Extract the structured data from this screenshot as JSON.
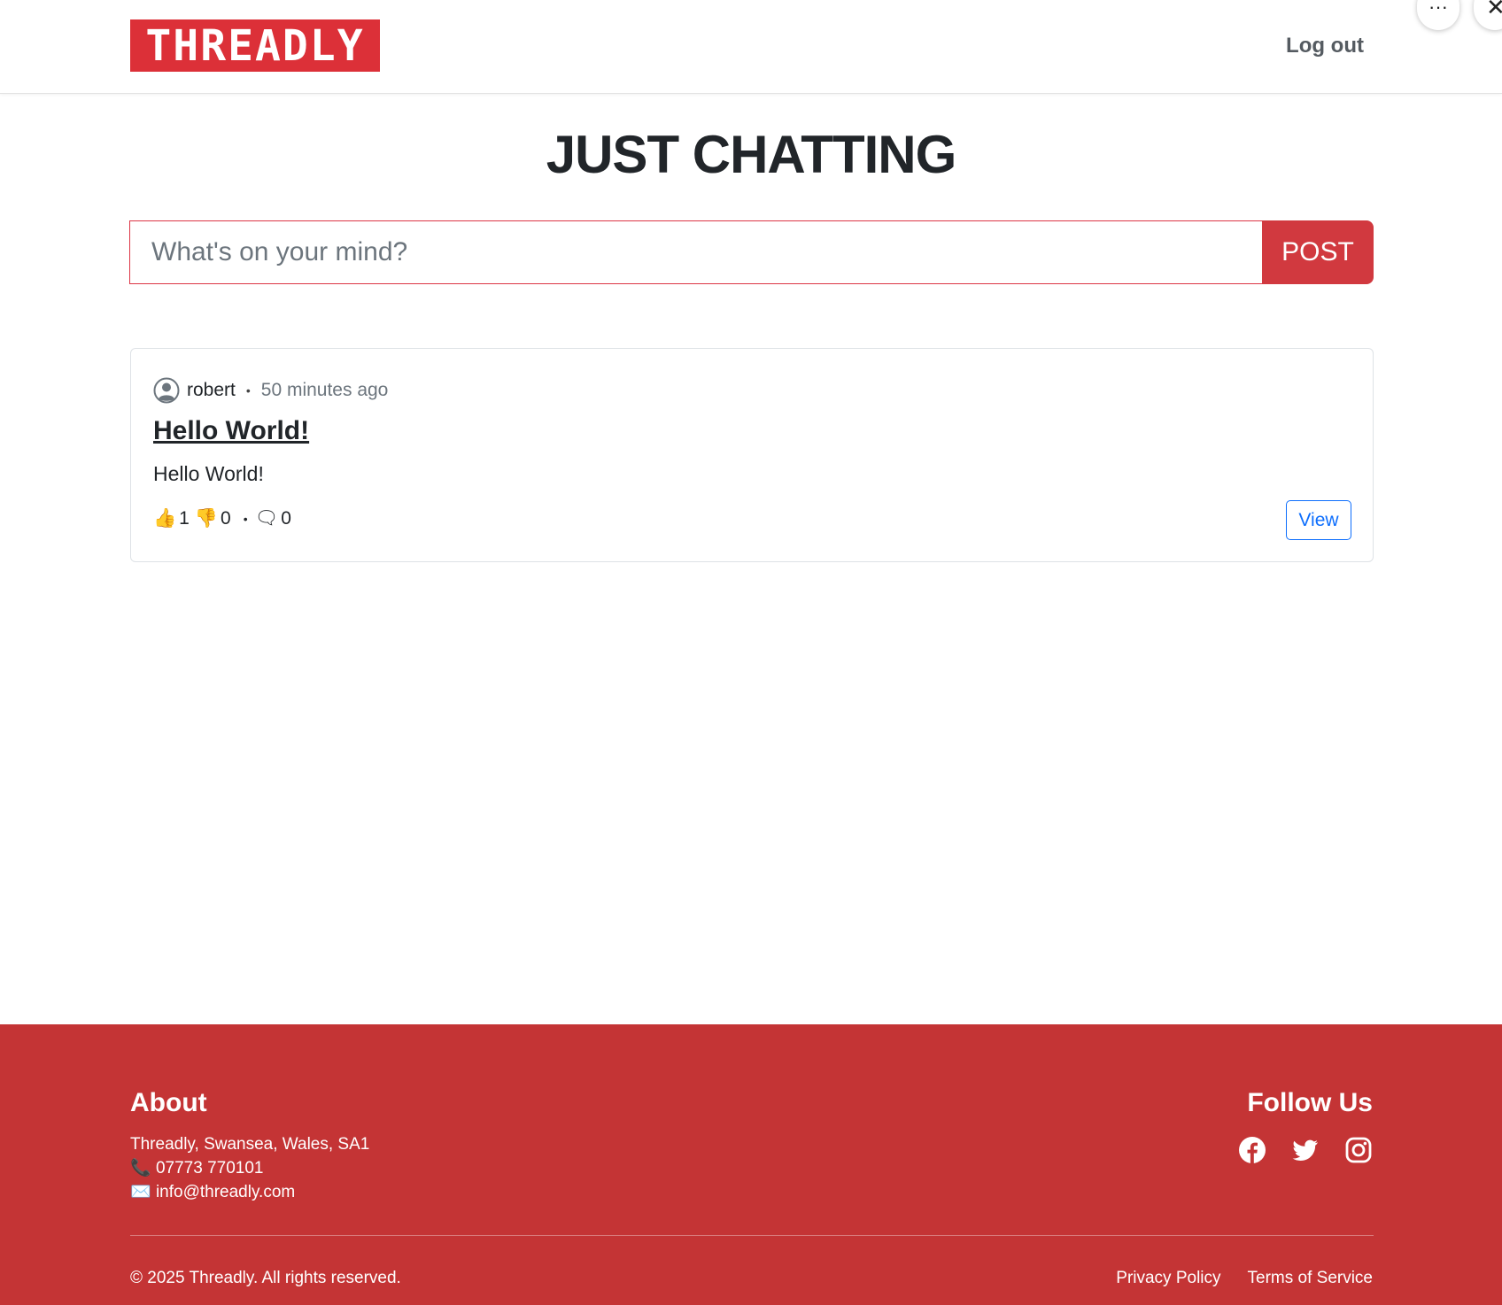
{
  "header": {
    "logo_text": "THREADLY",
    "logout_label": "Log out",
    "more_icon": "ellipsis-icon",
    "close_icon": "close-icon"
  },
  "page": {
    "title": "JUST CHATTING"
  },
  "post_form": {
    "placeholder": "What's on your mind?",
    "button_label": "POST"
  },
  "posts": [
    {
      "author": "robert",
      "time": "50 minutes ago",
      "title": "Hello World!",
      "body": "Hello World!",
      "likes": "1",
      "dislikes": "0",
      "comments": "0",
      "view_label": "View"
    }
  ],
  "footer": {
    "about_title": "About",
    "address": "Threadly, Swansea, Wales, SA1",
    "phone": "07773 770101",
    "email": "info@threadly.com",
    "follow_title": "Follow Us",
    "socials": [
      "facebook-icon",
      "twitter-icon",
      "instagram-icon"
    ],
    "copyright": "© 2025 Threadly. All rights reserved.",
    "privacy_label": "Privacy Policy",
    "terms_label": "Terms of Service"
  },
  "colors": {
    "brand_red": "#dc3038",
    "footer_red": "#c43435",
    "link_blue": "#0d6efd"
  }
}
